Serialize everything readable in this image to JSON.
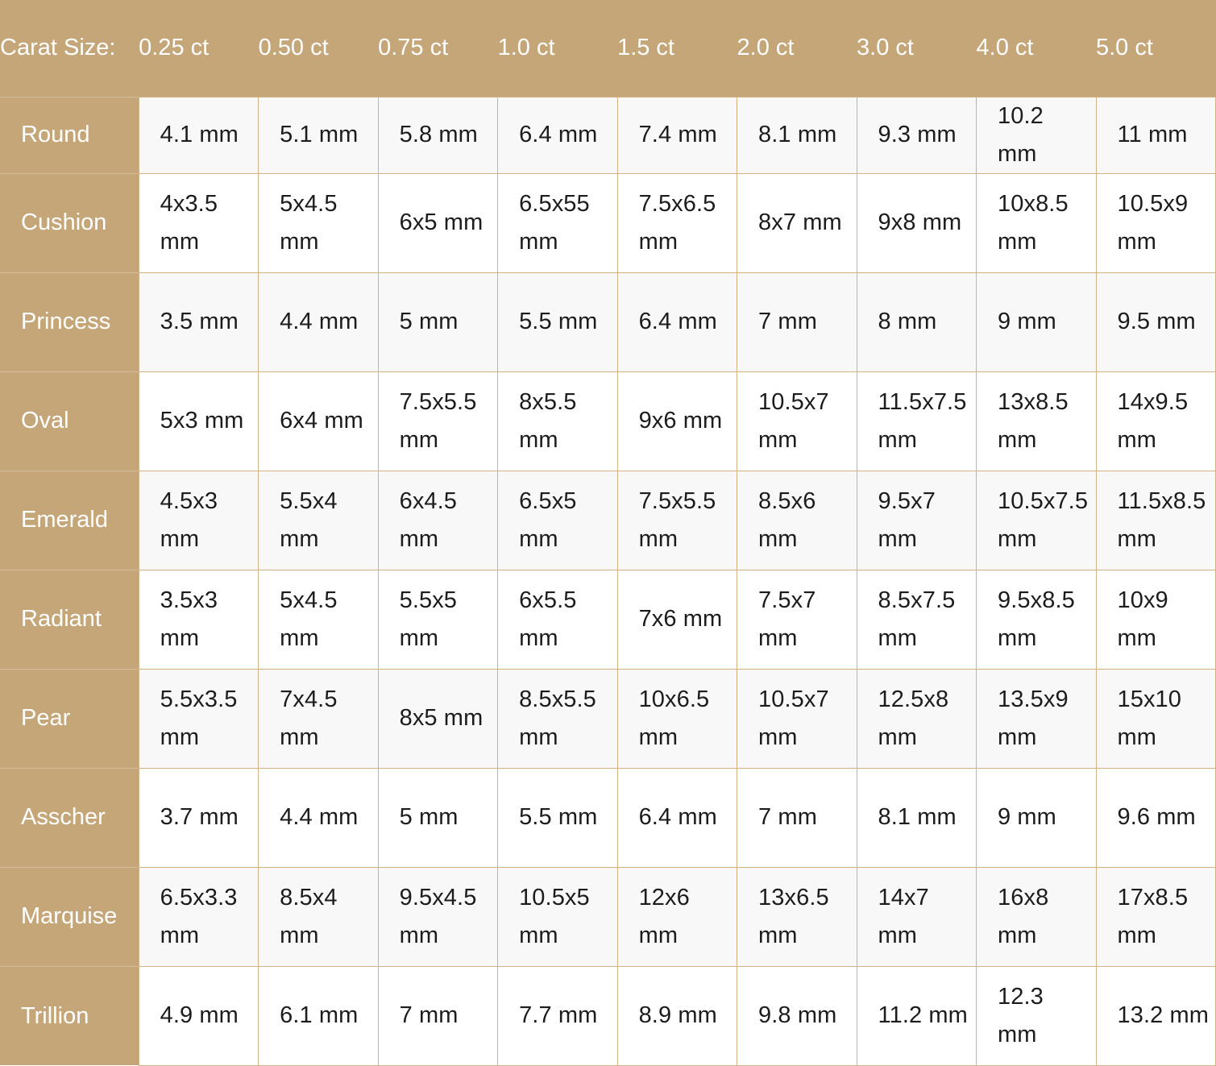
{
  "table": {
    "corner_label": "Carat Size:",
    "colors": {
      "header_background": "#c5a678",
      "header_text": "#ffffff",
      "cell_border": "#d2b184",
      "shaded_row_background": "#f8f8f8",
      "plain_row_background": "#ffffff",
      "cell_text": "#1c1c1c"
    },
    "column_headers": [
      "0.25 ct",
      "0.50 ct",
      "0.75 ct",
      "1.0 ct",
      "1.5 ct",
      "2.0 ct",
      "3.0 ct",
      "4.0 ct",
      "5.0 ct"
    ],
    "rows": [
      {
        "shape": "Round",
        "values": [
          "4.1 mm",
          "5.1 mm",
          "5.8 mm",
          "6.4 mm",
          "7.4 mm",
          "8.1 mm",
          "9.3 mm",
          "10.2 mm",
          "11 mm"
        ]
      },
      {
        "shape": "Cushion",
        "values": [
          "4x3.5 mm",
          "5x4.5 mm",
          "6x5 mm",
          "6.5x55 mm",
          "7.5x6.5 mm",
          "8x7 mm",
          "9x8 mm",
          "10x8.5 mm",
          "10.5x9 mm"
        ]
      },
      {
        "shape": "Princess",
        "values": [
          "3.5 mm",
          "4.4 mm",
          "5 mm",
          "5.5 mm",
          "6.4 mm",
          "7 mm",
          "8 mm",
          "9 mm",
          "9.5 mm"
        ]
      },
      {
        "shape": "Oval",
        "values": [
          "5x3 mm",
          "6x4 mm",
          "7.5x5.5 mm",
          "8x5.5 mm",
          "9x6 mm",
          "10.5x7 mm",
          "11.5x7.5 mm",
          "13x8.5 mm",
          "14x9.5 mm"
        ]
      },
      {
        "shape": "Emerald",
        "values": [
          "4.5x3 mm",
          "5.5x4 mm",
          "6x4.5 mm",
          "6.5x5 mm",
          "7.5x5.5 mm",
          "8.5x6 mm",
          "9.5x7 mm",
          "10.5x7.5 mm",
          "11.5x8.5 mm"
        ]
      },
      {
        "shape": "Radiant",
        "values": [
          "3.5x3 mm",
          "5x4.5 mm",
          "5.5x5 mm",
          "6x5.5 mm",
          "7x6 mm",
          "7.5x7 mm",
          "8.5x7.5 mm",
          "9.5x8.5 mm",
          "10x9 mm"
        ]
      },
      {
        "shape": "Pear",
        "values": [
          "5.5x3.5 mm",
          "7x4.5 mm",
          "8x5 mm",
          "8.5x5.5 mm",
          "10x6.5 mm",
          "10.5x7 mm",
          "12.5x8 mm",
          "13.5x9 mm",
          "15x10 mm"
        ]
      },
      {
        "shape": "Asscher",
        "values": [
          "3.7 mm",
          "4.4 mm",
          "5 mm",
          "5.5 mm",
          "6.4 mm",
          "7 mm",
          "8.1 mm",
          "9 mm",
          "9.6 mm"
        ]
      },
      {
        "shape": "Marquise",
        "values": [
          "6.5x3.3 mm",
          "8.5x4 mm",
          "9.5x4.5 mm",
          "10.5x5 mm",
          "12x6 mm",
          "13x6.5 mm",
          "14x7 mm",
          "16x8 mm",
          "17x8.5 mm"
        ]
      },
      {
        "shape": "Trillion",
        "values": [
          "4.9 mm",
          "6.1 mm",
          "7 mm",
          "7.7 mm",
          "8.9 mm",
          "9.8 mm",
          "11.2 mm",
          "12.3 mm",
          "13.2 mm"
        ]
      }
    ]
  }
}
